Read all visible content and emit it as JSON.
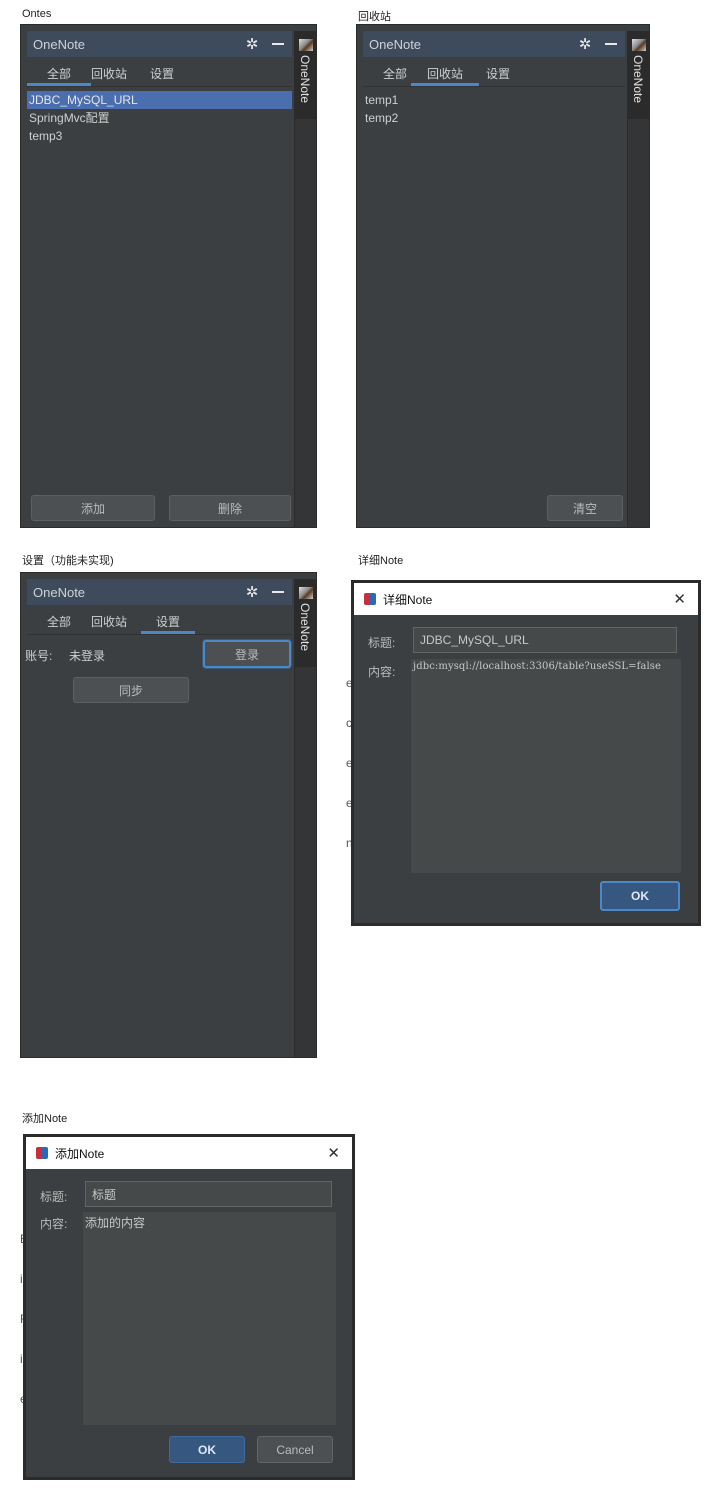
{
  "captions": {
    "all": "Ontes",
    "recycle": "回收站",
    "settings": "设置（功能未实现)",
    "detail": "详细Note",
    "add": "添加Note"
  },
  "plugin": {
    "title": "OneNote",
    "side_label": "OneNote",
    "icons": {
      "settings": "gear-icon",
      "minimize": "minus-icon"
    },
    "tabs": [
      "全部",
      "回收站",
      "设置"
    ]
  },
  "panel_all": {
    "active_tab": "全部",
    "items": [
      "JDBC_MySQL_URL",
      "SpringMvc配置",
      "temp3"
    ],
    "selected_index": 0,
    "add_button": "添加",
    "delete_button": "删除"
  },
  "panel_recycle": {
    "active_tab": "回收站",
    "items": [
      "temp1",
      "temp2"
    ],
    "clear_button": "清空"
  },
  "panel_settings": {
    "active_tab": "设置",
    "account_label": "账号:",
    "account_value": "未登录",
    "login_button": "登录",
    "sync_button": "同步"
  },
  "dialog_detail": {
    "title": "详细Note",
    "title_label": "标题:",
    "title_value": "JDBC_MySQL_URL",
    "content_label": "内容:",
    "content_value": "jdbc:mysql://localhost:3306/table?useSSL=false",
    "ok_button": "OK"
  },
  "dialog_add": {
    "title": "添加Note",
    "title_label": "标题:",
    "title_value": "标题",
    "content_label": "内容:",
    "content_value": "添加的内容",
    "ok_button": "OK",
    "cancel_button": "Cancel"
  },
  "fragments": {
    "detail_left": [
      "e",
      "c",
      "e",
      "e",
      "n"
    ],
    "add_left": [
      "E",
      "i",
      "F",
      "i",
      "e"
    ]
  },
  "colors": {
    "panel_bg": "#3c3f41",
    "titlebar_bg": "#3d4b5c",
    "accent": "#4a88c7",
    "selection": "#4b6eaf",
    "ok_button": "#365880"
  }
}
